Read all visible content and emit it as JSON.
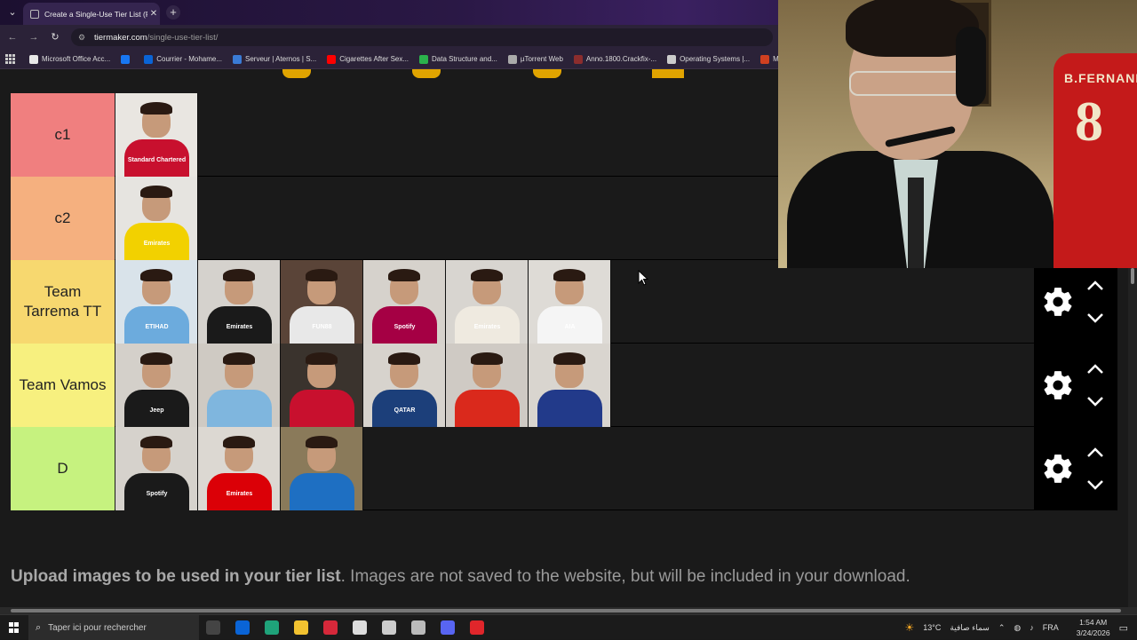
{
  "browser": {
    "tab_title": "Create a Single-Use Tier List (Pic",
    "tab_close": "✕",
    "new_tab": "+",
    "url_host": "tiermaker.com",
    "url_path": "/single-use-tier-list/",
    "bookmarks": [
      {
        "label": "Microsoft Office Acc...",
        "color": "#e8e8e8"
      },
      {
        "label": "",
        "color": "#1877f2"
      },
      {
        "label": "Courrier - Mohame...",
        "color": "#0a64d6"
      },
      {
        "label": "Serveur | Aternos | S...",
        "color": "#3a7bd5"
      },
      {
        "label": "Cigarettes After Sex...",
        "color": "#ff0000"
      },
      {
        "label": "Data Structure and...",
        "color": "#2bb24c"
      },
      {
        "label": "µTorrent Web",
        "color": "#aaaaaa"
      },
      {
        "label": "Anno.1800.Crackfix-...",
        "color": "#8c2d2d"
      },
      {
        "label": "Operating Systems |...",
        "color": "#cccccc"
      },
      {
        "label": "My",
        "color": "#d04020"
      }
    ]
  },
  "tiers": [
    {
      "label": "c1",
      "color": "#f07f7f",
      "items": [
        {
          "bg": "#e9e6e1",
          "shirt": "#c8102e",
          "sponsor": "Standard Chartered"
        }
      ]
    },
    {
      "label": "c2",
      "color": "#f5b07f",
      "items": [
        {
          "bg": "#e6e4e0",
          "shirt": "#f2d100",
          "sponsor": "Emirates"
        }
      ]
    },
    {
      "label": "Team Tarrema TT",
      "color": "#f7d86f",
      "items": [
        {
          "bg": "#d9e3ea",
          "shirt": "#6cabdd",
          "sponsor": "ETIHAD"
        },
        {
          "bg": "#d5d2cd",
          "shirt": "#1a1a1a",
          "sponsor": "Emirates"
        },
        {
          "bg": "#5a4438",
          "shirt": "#e8e8e8",
          "sponsor": "FUN88"
        },
        {
          "bg": "#d6d2cc",
          "shirt": "#a50044",
          "sponsor": "Spotify"
        },
        {
          "bg": "#d8d5d0",
          "shirt": "#efeae0",
          "sponsor": "Emirates"
        },
        {
          "bg": "#dedbd6",
          "shirt": "#f5f5f5",
          "sponsor": "AIA"
        }
      ]
    },
    {
      "label": "Team Vamos",
      "color": "#f7f07f",
      "items": [
        {
          "bg": "#d4d0ca",
          "shirt": "#1a1a1a",
          "sponsor": "Jeep"
        },
        {
          "bg": "#cfcac3",
          "shirt": "#7fb6de",
          "sponsor": ""
        },
        {
          "bg": "#3a332d",
          "shirt": "#c8102e",
          "sponsor": ""
        },
        {
          "bg": "#d7d3cd",
          "shirt": "#1c3f7a",
          "sponsor": "QATAR"
        },
        {
          "bg": "#cfcac4",
          "shirt": "#da291c",
          "sponsor": ""
        },
        {
          "bg": "#d9d5cf",
          "shirt": "#223a8a",
          "sponsor": ""
        }
      ]
    },
    {
      "label": "D",
      "color": "#c6f27f",
      "items": [
        {
          "bg": "#d6d2cc",
          "shirt": "#1a1a1a",
          "sponsor": "Spotify"
        },
        {
          "bg": "#dcd8d2",
          "shirt": "#db0007",
          "sponsor": "Emirates"
        },
        {
          "bg": "#8a7a5a",
          "shirt": "#1e6fc2",
          "sponsor": ""
        }
      ]
    }
  ],
  "upload": {
    "bold": "Upload images to be used in your tier list",
    "rest": ". Images are not saved to the website, but will be included in your download."
  },
  "webcam": {
    "jersey_name": "B.FERNANDES",
    "jersey_number": "8"
  },
  "taskbar": {
    "search_placeholder": "Taper ici pour rechercher",
    "weather": "13°C",
    "weather_text": "سماء صافية",
    "language": "FRA",
    "time": "1:54 AM",
    "date": "3/24/2026",
    "apps": [
      {
        "name": "task-view-icon",
        "color": "#444444"
      },
      {
        "name": "outlook-icon",
        "color": "#0a64d6"
      },
      {
        "name": "edge-icon",
        "color": "#1fa37a"
      },
      {
        "name": "explorer-icon",
        "color": "#f2c230"
      },
      {
        "name": "wps-icon",
        "color": "#d6283a"
      },
      {
        "name": "chrome-icon",
        "color": "#dddddd"
      },
      {
        "name": "obs-icon",
        "color": "#cccccc"
      },
      {
        "name": "app-icon",
        "color": "#bbbbbb"
      },
      {
        "name": "discord-icon",
        "color": "#5865f2"
      },
      {
        "name": "opera-icon",
        "color": "#e0262b"
      }
    ]
  }
}
